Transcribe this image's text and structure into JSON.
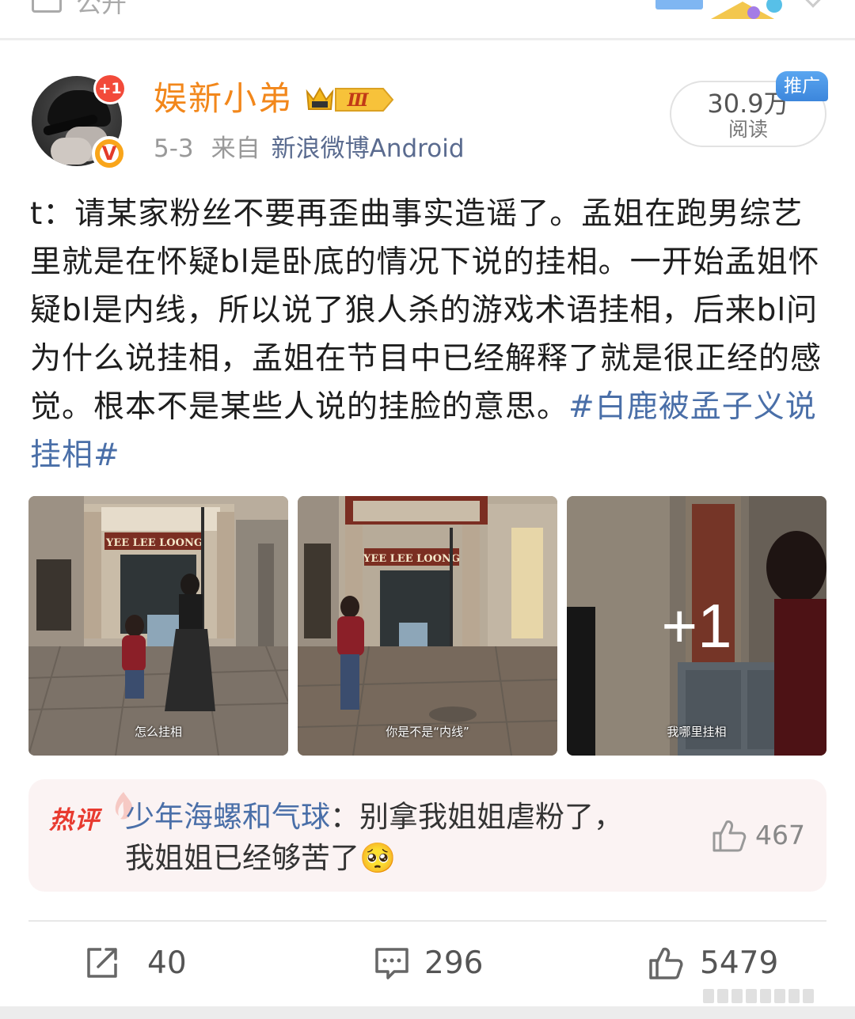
{
  "topbar": {
    "public_label": "公开"
  },
  "author": {
    "name": "娱新小弟",
    "avatar_badge": "+1",
    "verified_mark": "V",
    "level": "Ⅲ",
    "date": "5-3",
    "from_label": "来自",
    "source": "新浪微博Android"
  },
  "stats": {
    "reads_count": "30.9万",
    "reads_label": "阅读",
    "promo_tag": "推广"
  },
  "post": {
    "text": "t：请某家粉丝不要再歪曲事实造谣了。孟姐在跑男综艺里就是在怀疑bl是卧底的情况下说的挂相。一开始孟姐怀疑bl是内线，所以说了狼人杀的游戏术语挂相，后来bl问为什么说挂相，孟姐在节目中已经解释了就是很正经的感觉。根本不是某些人说的挂脸的意思。",
    "hashtag": "#白鹿被孟子义说挂相#"
  },
  "images": [
    {
      "caption": "怎么挂相",
      "sign_text": "YEE LEE LOONG"
    },
    {
      "caption": "你是不是“内线”",
      "sign_text": "YEE LEE LOONG"
    },
    {
      "caption": "我哪里挂相",
      "more": "+1"
    }
  ],
  "hot_comment": {
    "tag": "热评",
    "commenter": "少年海螺和气球",
    "separator": "：",
    "text": "别拿我姐姐虐粉了，我姐姐已经够苦了",
    "emoji": "🥺",
    "likes": "467"
  },
  "actions": {
    "shares": "40",
    "comments": "296",
    "likes": "5479"
  },
  "icons": {
    "share": "share-icon",
    "comment": "comment-icon",
    "like": "thumbs-up-icon",
    "level": "crown-icon"
  },
  "colors": {
    "username": "#f2871b",
    "link": "#4a6fa8",
    "hot_tag": "#e83a2f",
    "promo": "#3c86dc"
  }
}
